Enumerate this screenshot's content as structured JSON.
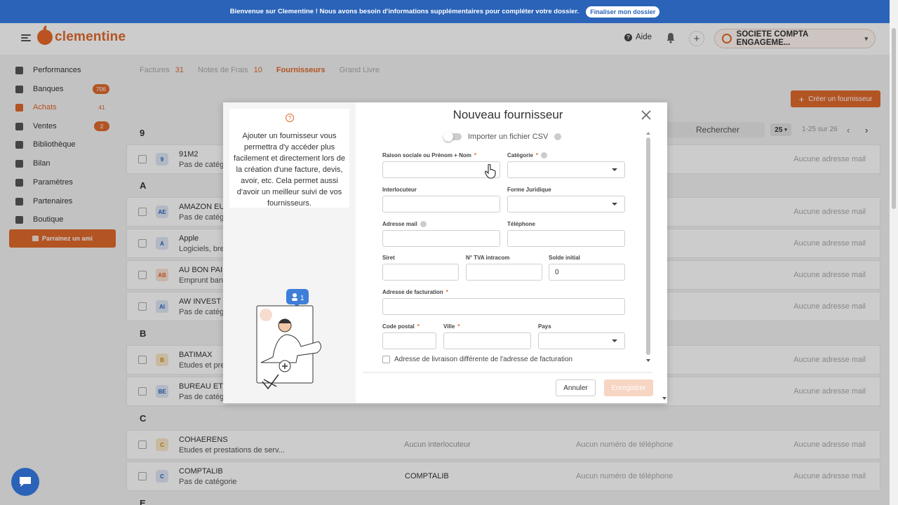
{
  "banner": {
    "message": "Bienvenue sur Clementine ! Nous avons besoin d'informations supplémentaires pour compléter votre dossier.",
    "button": "Finaliser mon dossier"
  },
  "header": {
    "logo": "clementine",
    "help": "Aide",
    "company": "SOCIETE COMPTA ENGAGEME..."
  },
  "sidebar": {
    "items": [
      {
        "label": "Performances",
        "badge": ""
      },
      {
        "label": "Banques",
        "badge": "706"
      },
      {
        "label": "Achats",
        "badge": "41"
      },
      {
        "label": "Ventes",
        "badge": "2"
      },
      {
        "label": "Bibliothèque",
        "badge": ""
      },
      {
        "label": "Bilan",
        "badge": ""
      },
      {
        "label": "Paramètres",
        "badge": ""
      },
      {
        "label": "Partenaires",
        "badge": ""
      },
      {
        "label": "Boutique",
        "badge": ""
      }
    ],
    "referral": "Parrainez un ami"
  },
  "main": {
    "tabs": [
      {
        "label": "Factures",
        "count": "31"
      },
      {
        "label": "Notes de Frais",
        "count": "10"
      },
      {
        "label": "Fournisseurs",
        "count": ""
      },
      {
        "label": "Grand Livre",
        "count": ""
      }
    ],
    "create_button": "Créer un fournisseur",
    "search_placeholder": "Rechercher",
    "per_page": "25",
    "page_info": "1-25 sur 26",
    "letters": [
      "9",
      "A",
      "B",
      "C",
      "E"
    ],
    "rows": [
      {
        "initials": "9",
        "name": "91M2",
        "category": "Pas de catégorie",
        "contact": "",
        "phone": "",
        "email": "Aucune adresse mail"
      },
      {
        "initials": "AE",
        "name": "AMAZON EU",
        "category": "Pas de catégorie",
        "contact": "",
        "phone": "",
        "email": "Aucune adresse mail"
      },
      {
        "initials": "A",
        "name": "Apple",
        "category": "Logiciels, bre",
        "contact": "",
        "phone": "",
        "email": "Aucune adresse mail"
      },
      {
        "initials": "AB",
        "name": "AU BON PAIN",
        "category": "Emprunt banc",
        "contact": "",
        "phone": "",
        "email": "Aucune adresse mail"
      },
      {
        "initials": "AI",
        "name": "AW INVEST",
        "category": "Pas de catég",
        "contact": "",
        "phone": "",
        "email": "Aucune adresse mail"
      },
      {
        "initials": "B",
        "name": "BATIMAX",
        "category": "Etudes et pre",
        "contact": "",
        "phone": "",
        "email": "Aucune adresse mail"
      },
      {
        "initials": "BE",
        "name": "BUREAU ETU",
        "category": "Pas de catég",
        "contact": "",
        "phone": "",
        "email": "Aucune adresse mail"
      },
      {
        "initials": "C",
        "name": "COHAERENS",
        "category": "Etudes et prestations de serv...",
        "contact": "Aucun interlocuteur",
        "phone": "Aucun numéro de téléphone",
        "email": "Aucune adresse mail"
      },
      {
        "initials": "C",
        "name": "COMPTALIB",
        "category": "Pas de catégorie",
        "contact": "COMPTALIB",
        "phone": "Aucun numéro de téléphone",
        "email": "Aucune adresse mail"
      }
    ]
  },
  "modal": {
    "title": "Nouveau fournisseur",
    "info_text": "Ajouter un fournisseur vous permettra d'y accéder plus facilement et directement lors de la création d'une facture, devis, avoir, etc. Cela permet aussi d'avoir un meilleur suivi de vos fournisseurs.",
    "illustration_count": "1",
    "import_csv": "Importer un fichier CSV",
    "fields": {
      "raison_sociale": {
        "label": "Raison sociale ou Prénom + Nom",
        "required": "*",
        "value": ""
      },
      "categorie": {
        "label": "Catégorie",
        "required": "*",
        "value": ""
      },
      "interlocuteur": {
        "label": "Interlocuteur",
        "value": ""
      },
      "forme_juridique": {
        "label": "Forme Juridique",
        "value": ""
      },
      "adresse_mail": {
        "label": "Adresse mail",
        "value": ""
      },
      "telephone": {
        "label": "Téléphone",
        "value": ""
      },
      "siret": {
        "label": "Siret",
        "value": ""
      },
      "tva": {
        "label": "N° TVA intracom",
        "value": ""
      },
      "solde": {
        "label": "Solde initial",
        "value": "0"
      },
      "adresse_facturation": {
        "label": "Adresse de facturation",
        "required": "*",
        "value": ""
      },
      "code_postal": {
        "label": "Code postal",
        "required": "*",
        "value": ""
      },
      "ville": {
        "label": "Ville",
        "required": "*",
        "value": ""
      },
      "pays": {
        "label": "Pays",
        "value": ""
      }
    },
    "delivery_checkbox": "Adresse de livraison différente de l'adresse de facturation",
    "cancel": "Annuler",
    "save": "Enregistrer"
  },
  "colors": {
    "brand": "#e0692c",
    "banner": "#2a63b8"
  }
}
